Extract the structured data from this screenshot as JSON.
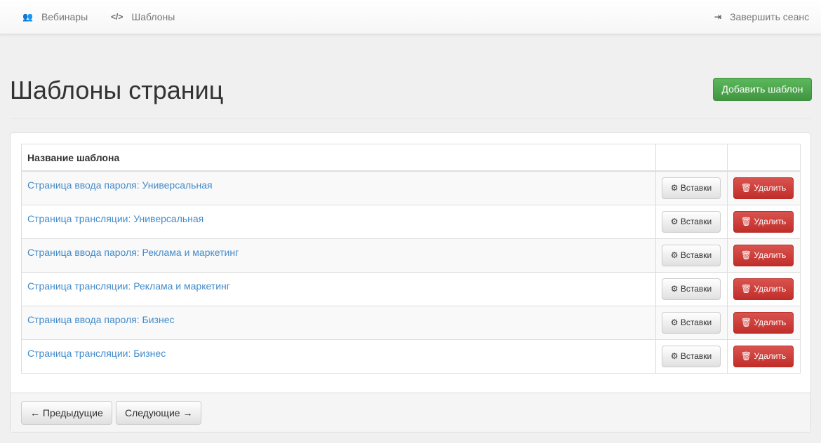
{
  "nav": {
    "webinars": "Вебинары",
    "templates": "Шаблоны",
    "logout": "Завершить сеанс",
    "icons": {
      "webinars": "users-icon",
      "templates": "code-icon",
      "logout": "sign-out-icon"
    }
  },
  "page": {
    "title": "Шаблоны страниц",
    "add_button": "Добавить шаблон"
  },
  "table": {
    "header": "Название шаблона",
    "rows": [
      {
        "name": "Страница ввода пароля: Универсальная"
      },
      {
        "name": "Страница трансляции: Универсальная"
      },
      {
        "name": "Страница ввода пароля: Реклама и маркетинг"
      },
      {
        "name": "Страница трансляции: Реклама и маркетинг"
      },
      {
        "name": "Страница ввода пароля: Бизнес"
      },
      {
        "name": "Страница трансляции: Бизнес"
      }
    ],
    "insert_label": "Вставки",
    "delete_label": "Удалить"
  },
  "pager": {
    "prev": "← Предыдущие",
    "next": "Следующие →"
  }
}
